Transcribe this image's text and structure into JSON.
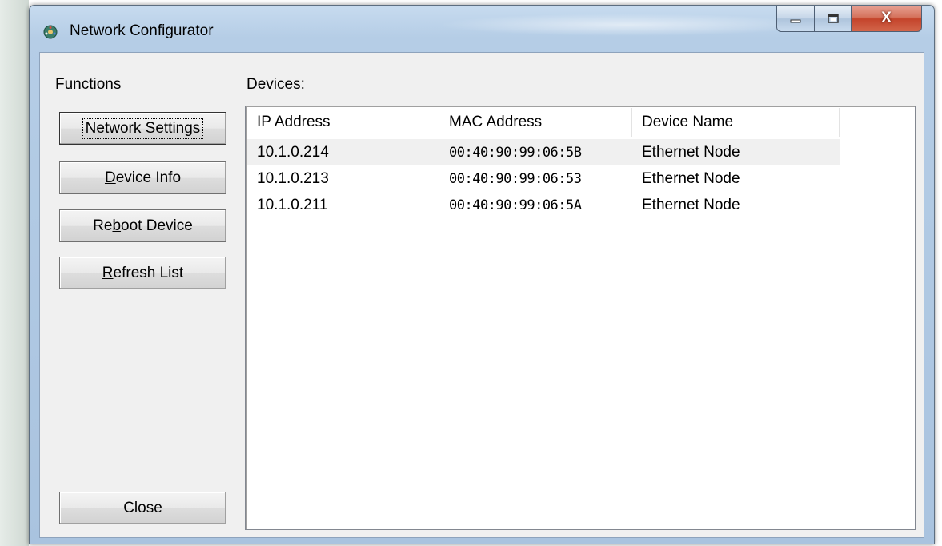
{
  "window": {
    "title": "Network Configurator",
    "min_label": "–",
    "max_label": "□",
    "close_label": "X"
  },
  "functions": {
    "heading": "Functions",
    "buttons": [
      {
        "pre": "",
        "key": "N",
        "post": "etwork Settings"
      },
      {
        "pre": "",
        "key": "D",
        "post": "evice Info"
      },
      {
        "pre": "Re",
        "key": "b",
        "post": "oot Device"
      },
      {
        "pre": "",
        "key": "R",
        "post": "efresh List"
      }
    ],
    "close_label": "Close"
  },
  "devices": {
    "heading": "Devices:",
    "columns": [
      "IP Address",
      "MAC Address",
      "Device Name",
      ""
    ],
    "rows": [
      {
        "ip": "10.1.0.214",
        "mac": "00:40:90:99:06:5B",
        "name": "Ethernet Node"
      },
      {
        "ip": "10.1.0.213",
        "mac": "00:40:90:99:06:53",
        "name": "Ethernet Node"
      },
      {
        "ip": "10.1.0.211",
        "mac": "00:40:90:99:06:5A",
        "name": "Ethernet Node"
      }
    ],
    "selected_row": 0
  },
  "colors": {
    "title_bar": "#b5cde6",
    "close_button": "#c4442b",
    "client_bg": "#f0f0f0",
    "selected_row": "#f0f0f0"
  }
}
